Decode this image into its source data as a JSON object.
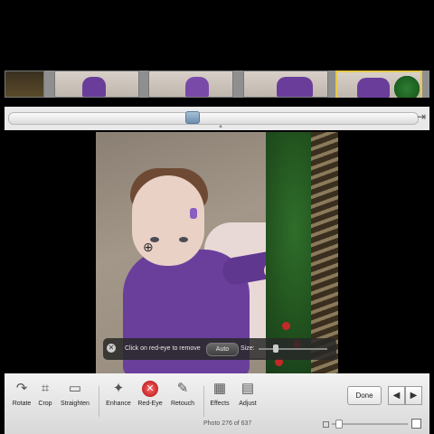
{
  "filmstrip": {
    "thumbnails": [
      "thumb-1",
      "thumb-2",
      "thumb-3",
      "thumb-4",
      "thumb-5"
    ]
  },
  "redeye_hud": {
    "message": "Click on red-eye to remove",
    "auto_label": "Auto",
    "size_label": "Size:"
  },
  "toolbar": {
    "tools": [
      {
        "label": "Rotate",
        "icon": "rotate-icon"
      },
      {
        "label": "Crop",
        "icon": "crop-icon"
      },
      {
        "label": "Straighten",
        "icon": "straighten-icon"
      },
      {
        "label": "Enhance",
        "icon": "magic-wand-icon"
      },
      {
        "label": "Red-Eye",
        "icon": "red-eye-icon"
      },
      {
        "label": "Retouch",
        "icon": "brush-icon"
      },
      {
        "label": "Effects",
        "icon": "grid-icon"
      },
      {
        "label": "Adjust",
        "icon": "adjust-icon"
      }
    ],
    "done_label": "Done",
    "prev_icon": "◀",
    "next_icon": "▶",
    "photo_counter": "Photo 276 of 637"
  },
  "colors": {
    "background": "#000000",
    "toolbar": "#e4e4e4",
    "hud": "#2b2b2b",
    "accent_selected": "#e8c84a"
  }
}
